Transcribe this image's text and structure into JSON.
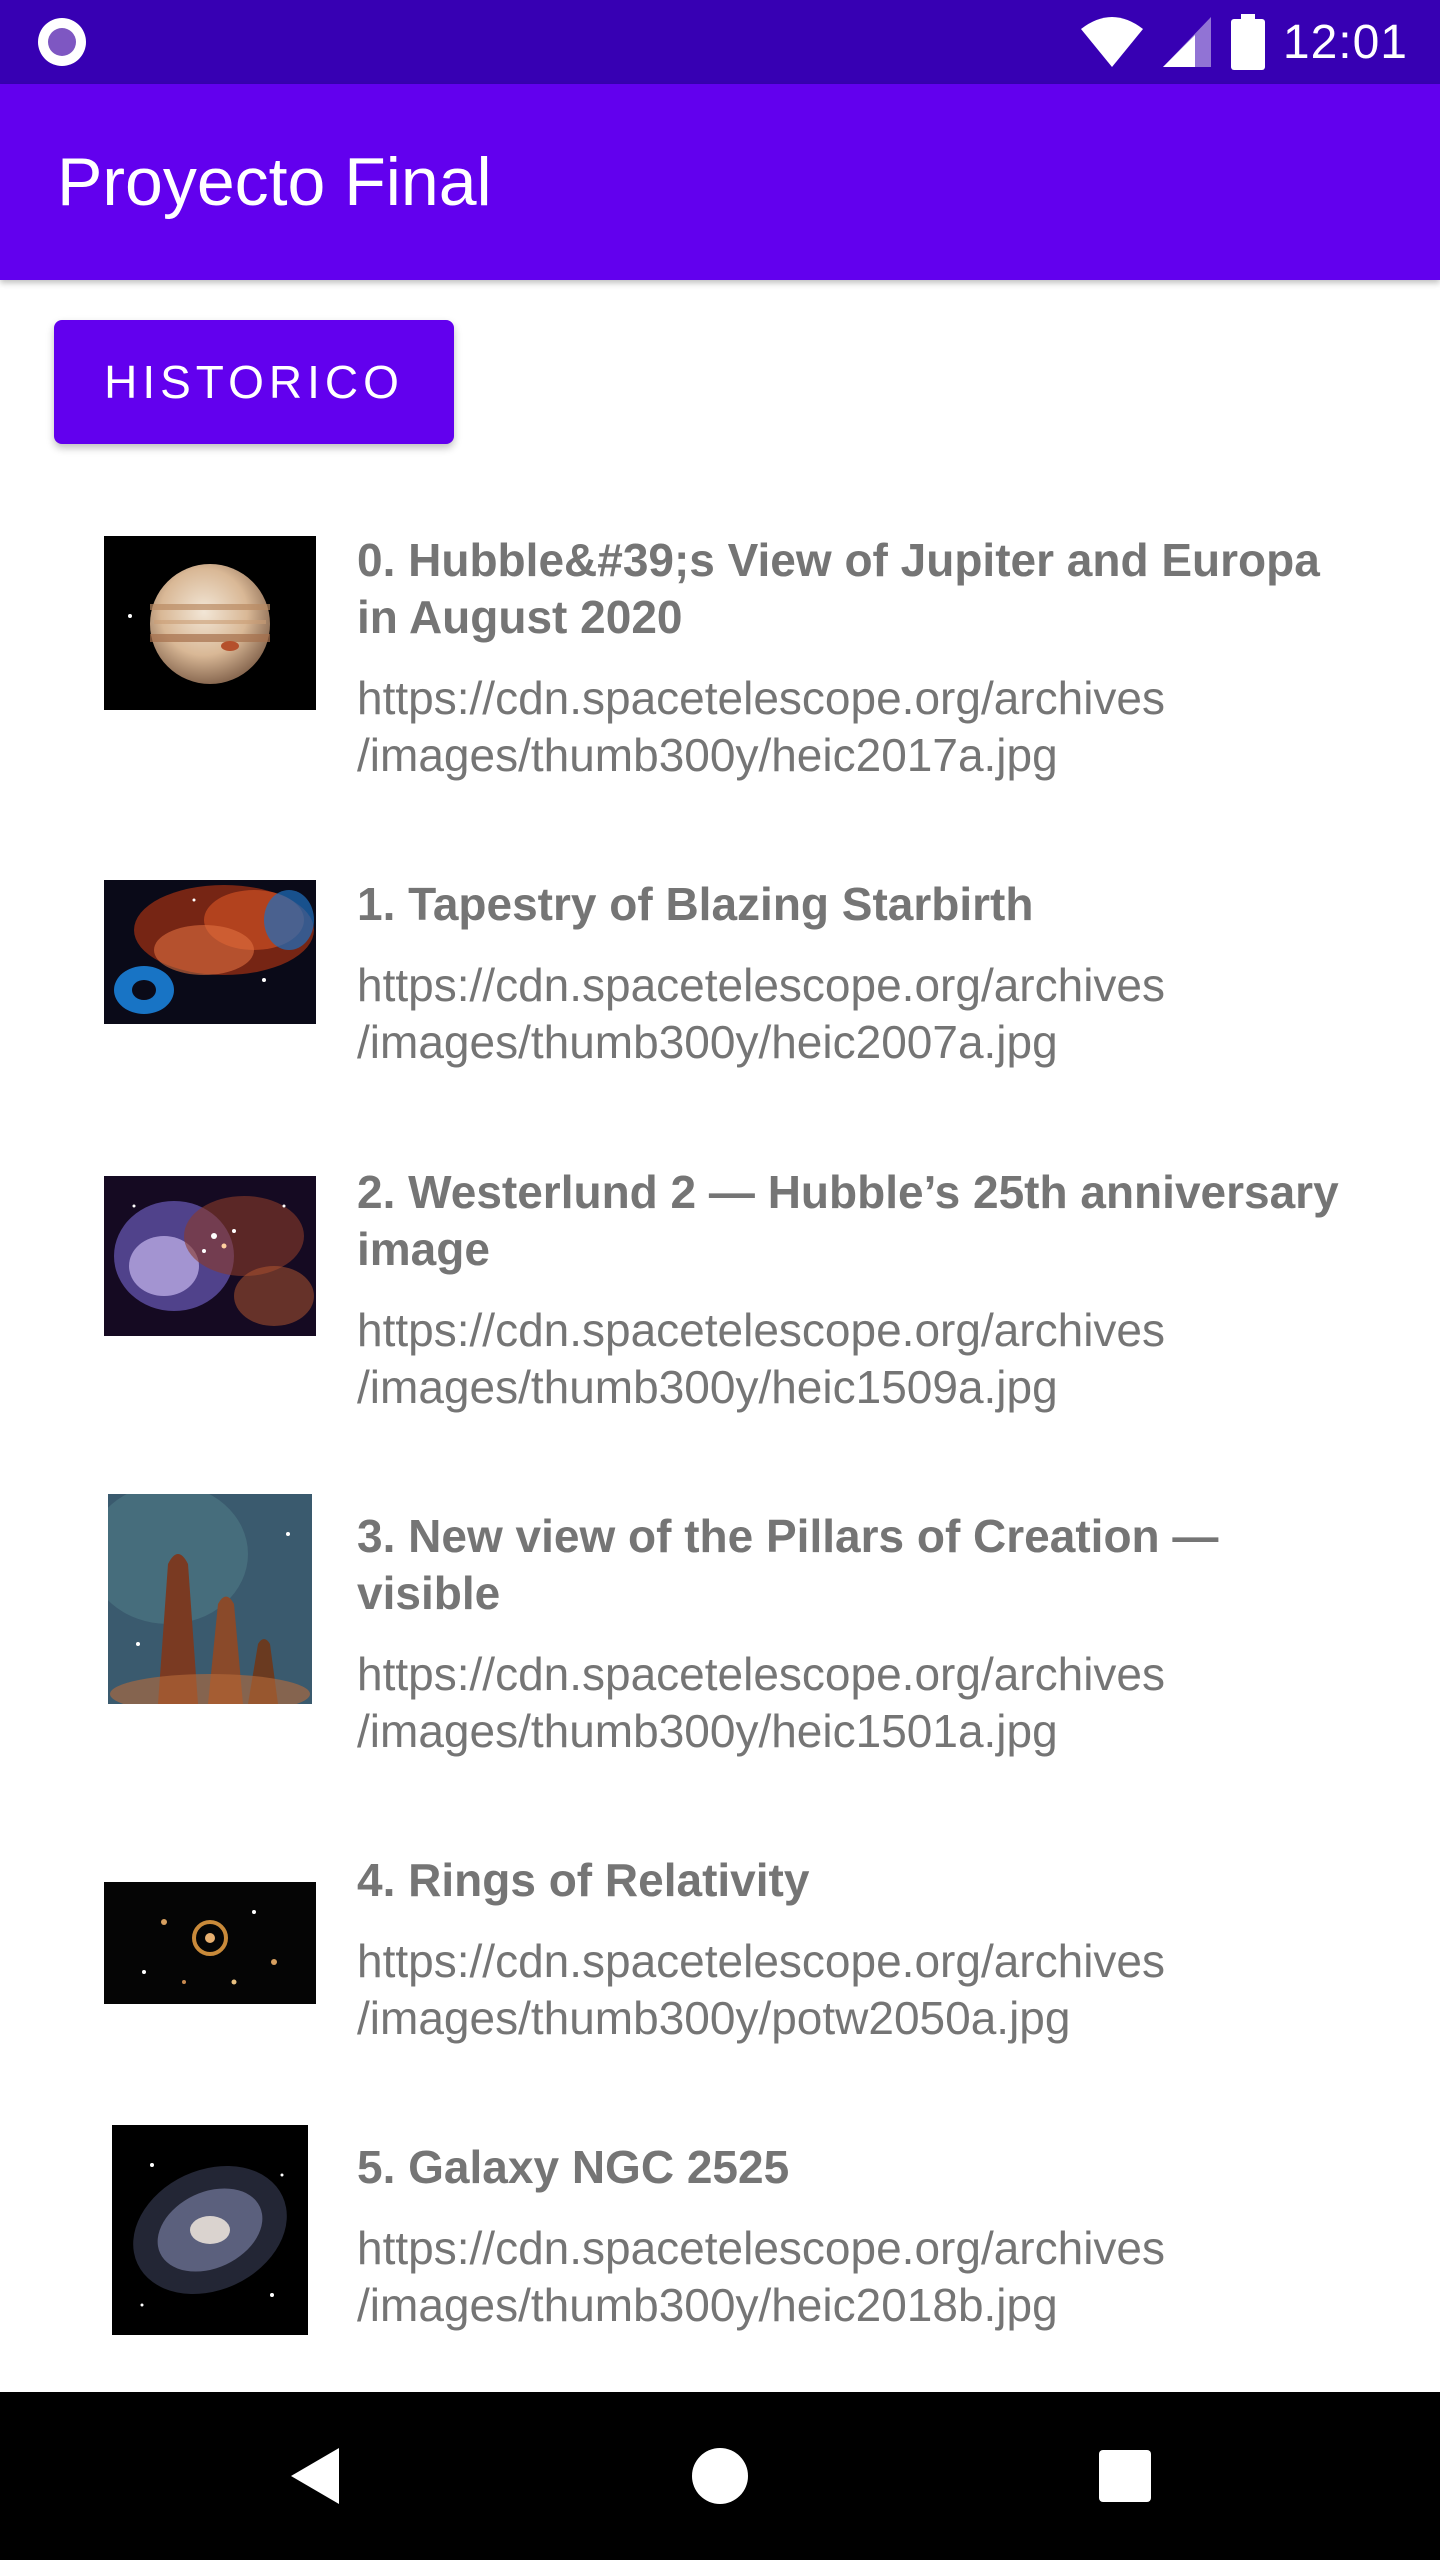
{
  "status_bar": {
    "time": "12:01"
  },
  "app_bar": {
    "title": "Proyecto Final"
  },
  "historico_button": {
    "label": "HISTORICO"
  },
  "items": [
    {
      "title": "0. Hubble&#39;s View of Jupiter and Europa in August 2020",
      "url": "https://cdn.spacetelescope.org/archives\n/images/thumb300y/heic2017a.jpg",
      "image": "jupiter-image"
    },
    {
      "title": "1. Tapestry of Blazing Starbirth",
      "url": "https://cdn.spacetelescope.org/archives\n/images/thumb300y/heic2007a.jpg",
      "image": "nebula-image"
    },
    {
      "title": "2. Westerlund 2 — Hubble’s 25th anniversary image",
      "url": "https://cdn.spacetelescope.org/archives\n/images/thumb300y/heic1509a.jpg",
      "image": "star-cluster-image"
    },
    {
      "title": "3. New view of the Pillars of Creation — visible",
      "url": "https://cdn.spacetelescope.org/archives\n/images/thumb300y/heic1501a.jpg",
      "image": "pillars-image"
    },
    {
      "title": "4. Rings of Relativity",
      "url": "https://cdn.spacetelescope.org/archives\n/images/thumb300y/potw2050a.jpg",
      "image": "galaxy-field-image"
    },
    {
      "title": "5. Galaxy NGC 2525",
      "url": "https://cdn.spacetelescope.org/archives\n/images/thumb300y/heic2018b.jpg",
      "image": "spiral-galaxy-image"
    }
  ],
  "colors": {
    "primary": "#6200ee",
    "primary_dark": "#3700b3",
    "text_secondary": "#757575"
  },
  "nav_bar": {
    "back_icon": "back-triangle-icon",
    "home_icon": "home-circle-icon",
    "recents_icon": "recents-square-icon"
  }
}
